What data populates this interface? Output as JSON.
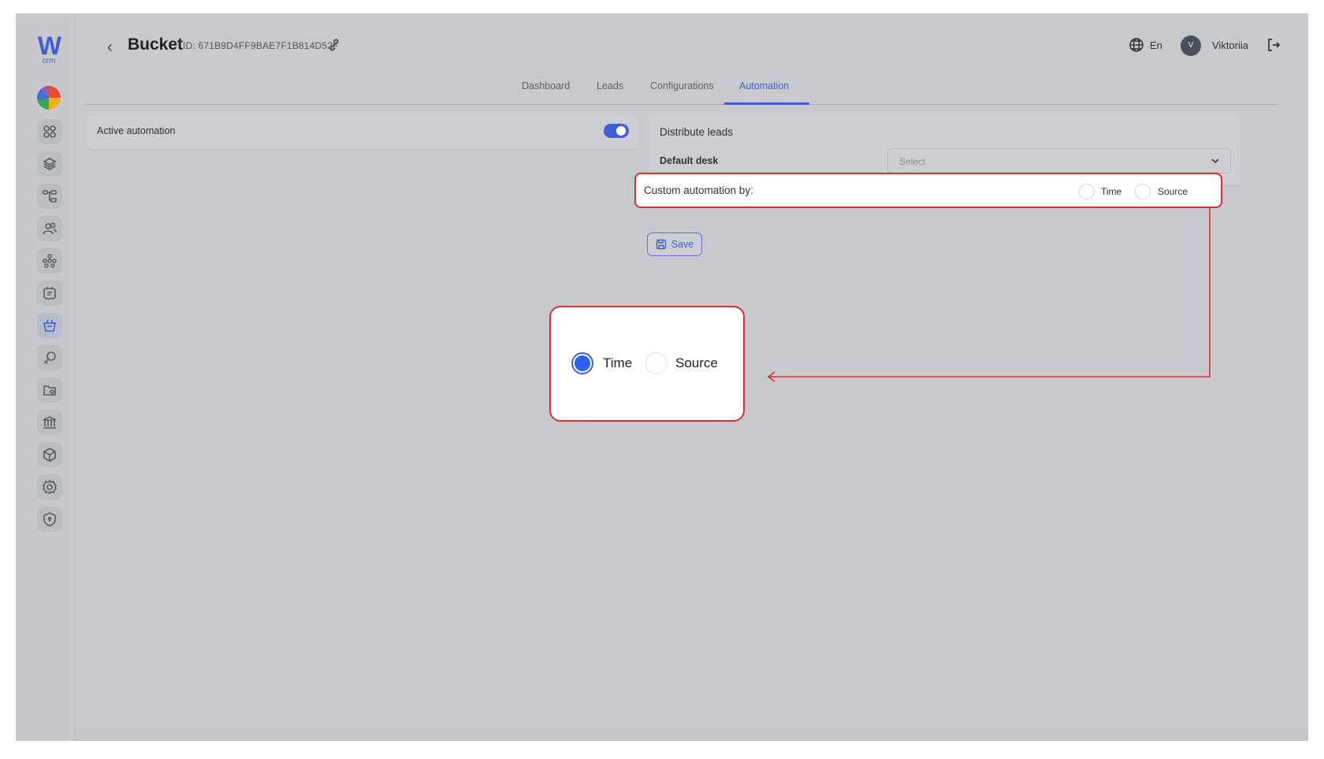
{
  "brand": {
    "logo_letter": "W",
    "logo_sub": "crm"
  },
  "sidebar": {
    "items": [
      {
        "icon": "dashboard-icon"
      },
      {
        "icon": "layers-icon"
      },
      {
        "icon": "hierarchy-icon"
      },
      {
        "icon": "users-icon"
      },
      {
        "icon": "network-icon"
      },
      {
        "icon": "notes-icon"
      },
      {
        "icon": "bucket-icon",
        "active": true
      },
      {
        "icon": "key-icon"
      },
      {
        "icon": "folder-user-icon"
      },
      {
        "icon": "bank-icon"
      },
      {
        "icon": "box-icon"
      },
      {
        "icon": "settings-icon"
      },
      {
        "icon": "shield-icon"
      }
    ]
  },
  "header": {
    "back_symbol": "‹",
    "title": "Bucket",
    "id_text": "ID: 671B9D4FF9BAE7F1B814D52F",
    "language": "En",
    "avatar_initial": "V",
    "user_name": "Viktoriia"
  },
  "tabs": [
    {
      "label": "Dashboard"
    },
    {
      "label": "Leads"
    },
    {
      "label": "Configurations"
    },
    {
      "label": "Automation",
      "active": true
    }
  ],
  "automation": {
    "label": "Active automation",
    "enabled": true
  },
  "distribute": {
    "title": "Distribute leads",
    "default_desk_label": "Default desk",
    "select_placeholder": "Select"
  },
  "custom_automation": {
    "label": "Custom automation by:",
    "options": [
      "Time",
      "Source"
    ]
  },
  "save_label": "Save",
  "zoom": {
    "options": [
      "Time",
      "Source"
    ],
    "selected": "Time"
  },
  "colors": {
    "accent": "#3f5fd6",
    "highlight_border": "#d93030",
    "radio_selected": "#2d5ff0",
    "overlay": "#c8c9cc"
  }
}
